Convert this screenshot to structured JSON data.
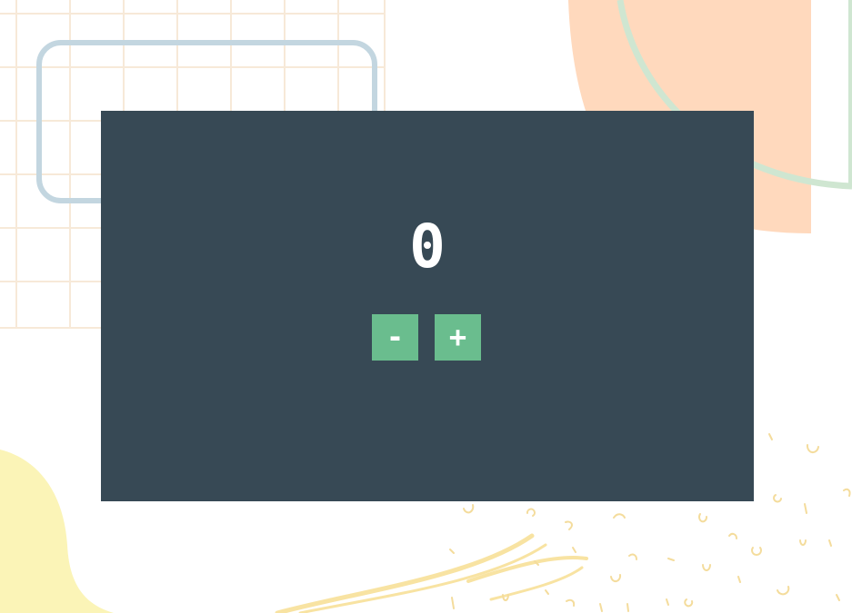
{
  "counter": {
    "value": "0",
    "decrement_label": "-",
    "increment_label": "+"
  },
  "colors": {
    "card_background": "#374955",
    "button_background": "#6abd8e",
    "text": "#ffffff",
    "grid_lines": "#f7e9d8",
    "blue_frame": "#c3d6e0",
    "peach_shape": "#ffd9bd",
    "mint_arc": "#cfe6d1",
    "yellow_blob": "#fbf4b7",
    "yellow_doodles": "#f4dc9c"
  }
}
